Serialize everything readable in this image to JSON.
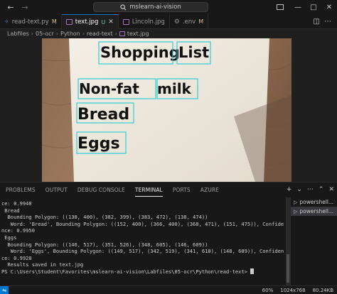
{
  "titlebar": {
    "search": "mslearn-ai-vision"
  },
  "tabs": [
    {
      "label": "read-text.py",
      "badge": "M",
      "icon": "python-icon",
      "active": false
    },
    {
      "label": "text.jpg",
      "badge": "U",
      "icon": "image-icon",
      "active": true
    },
    {
      "label": "Lincoln.jpg",
      "badge": "",
      "icon": "image-icon",
      "active": false
    },
    {
      "label": ".env",
      "badge": "M",
      "icon": "gear-icon",
      "active": false
    }
  ],
  "breadcrumb": [
    "Labfiles",
    "05-ocr",
    "Python",
    "read-text",
    "text.jpg"
  ],
  "image": {
    "words": [
      "Shopping",
      "List",
      "Non-fat",
      "milk",
      "Bread",
      "Eggs"
    ]
  },
  "panel": {
    "tabs": [
      "PROBLEMS",
      "OUTPUT",
      "DEBUG CONSOLE",
      "TERMINAL",
      "PORTS",
      "AZURE"
    ],
    "active_tab": "TERMINAL",
    "terminal_lines": [
      "ce: 0.9940",
      " Bread",
      "  Bounding Polygon: ((138, 400), (382, 399), (383, 472), (138, 474))",
      "   Word: 'Bread', Bounding Polygon: ((152, 400), (366, 400), (368, 471), (151, 475)), Confide",
      "nce: 0.9950",
      " Eggs",
      "  Bounding Polygon: ((146, 517), (351, 526), (348, 605), (146, 609))",
      "   Word: 'Eggs', Bounding Polygon: ((149, 517), (342, 519), (341, 610), (148, 609)), Confiden",
      "ce: 0.9920",
      "",
      "  Results saved in text.jpg",
      "PS C:\\Users\\Student\\Favorites\\mslearn-ai-vision\\Labfiles\\05-ocr\\Python\\read-text> "
    ],
    "terminals": [
      "powershell...",
      "powershell..."
    ]
  },
  "statusbar": {
    "zoom": "60%",
    "dimensions": "1024x768",
    "size": "80.24KB"
  }
}
